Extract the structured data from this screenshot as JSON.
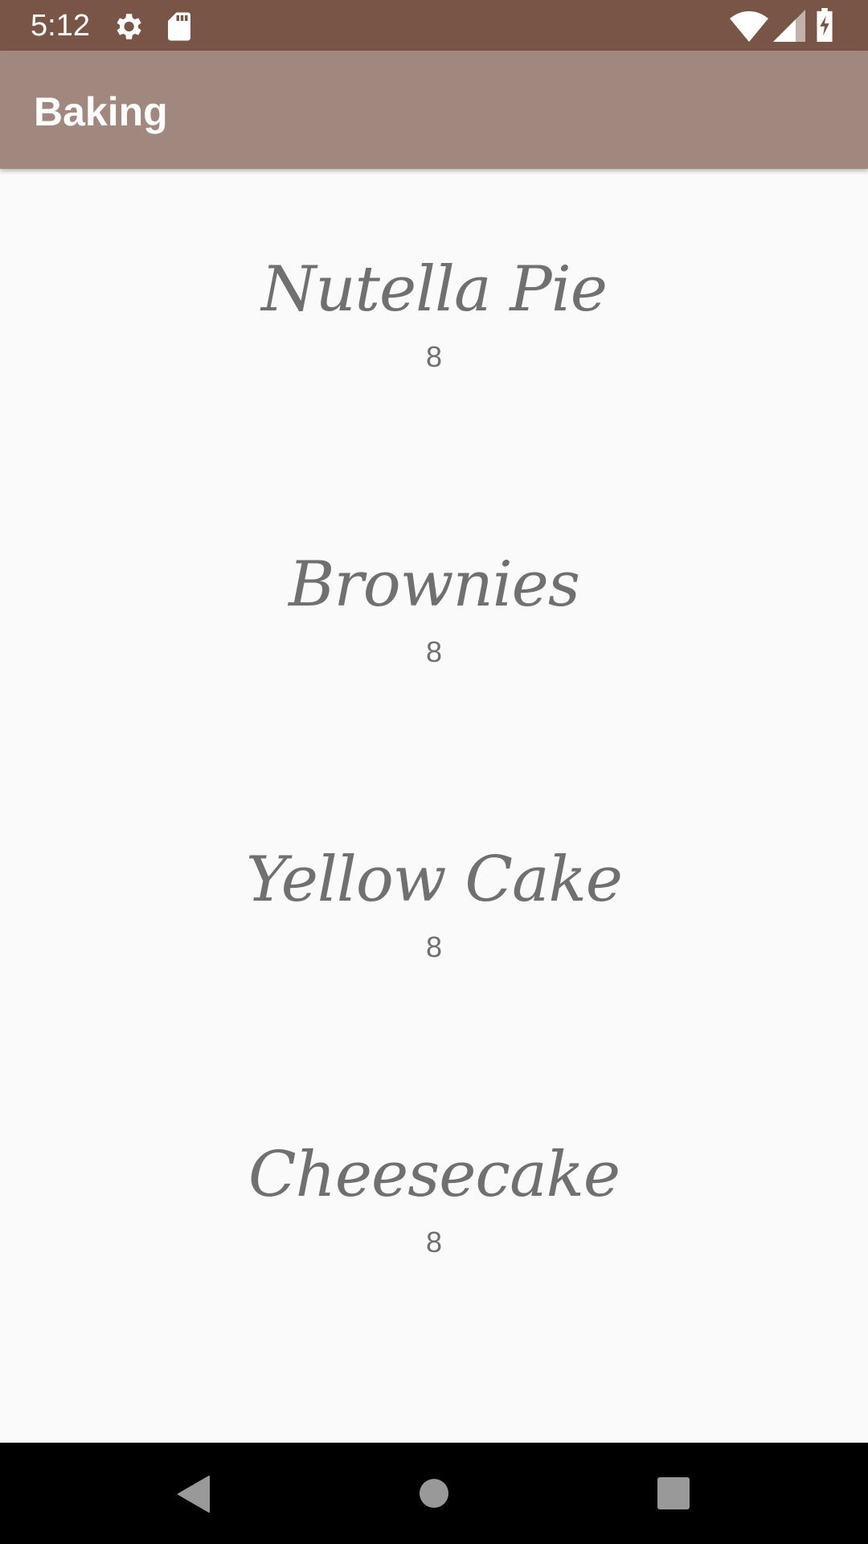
{
  "status_bar": {
    "time": "5:12",
    "icons": [
      "settings-gear-icon",
      "sd-card-icon",
      "wifi-icon",
      "cell-signal-icon",
      "battery-charging-icon"
    ],
    "color": "#795548"
  },
  "app_bar": {
    "title": "Baking",
    "color": "#a1887f"
  },
  "recipes": [
    {
      "name": "Nutella Pie",
      "servings": "8"
    },
    {
      "name": "Brownies",
      "servings": "8"
    },
    {
      "name": "Yellow Cake",
      "servings": "8"
    },
    {
      "name": "Cheesecake",
      "servings": "8"
    }
  ],
  "nav_bar": {
    "buttons": [
      "back-icon",
      "home-icon",
      "recents-icon"
    ]
  }
}
